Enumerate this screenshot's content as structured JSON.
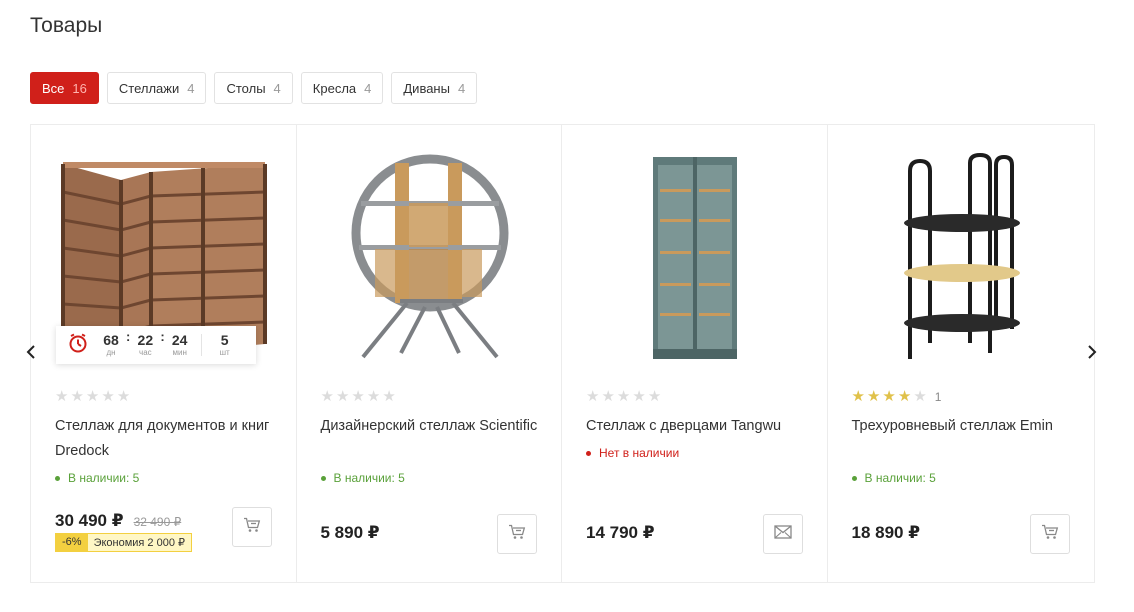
{
  "page": {
    "title": "Товары"
  },
  "filters": [
    {
      "label": "Все",
      "count": "16"
    },
    {
      "label": "Стеллажи",
      "count": "4"
    },
    {
      "label": "Столы",
      "count": "4"
    },
    {
      "label": "Кресла",
      "count": "4"
    },
    {
      "label": "Диваны",
      "count": "4"
    }
  ],
  "products": [
    {
      "name": "Стеллаж для документов и книг Dredock",
      "rating": 0,
      "stock": "В наличии: 5",
      "price": "30 490 ₽",
      "old_price": "32 490 ₽",
      "discount": "-6%",
      "economy": "Экономия 2 000 ₽",
      "action_icon": "cart-icon",
      "timer": {
        "days": "68",
        "days_label": "дн",
        "hours": "22",
        "hours_label": "час",
        "minutes": "24",
        "minutes_label": "мин",
        "qty": "5",
        "qty_label": "шт"
      }
    },
    {
      "name": "Дизайнерский стеллаж Scientific",
      "rating": 0,
      "stock": "В наличии: 5",
      "price": "5 890 ₽",
      "action_icon": "cart-icon"
    },
    {
      "name": "Стеллаж с дверцами Tangwu",
      "rating": 0,
      "stock": "Нет в наличии",
      "price": "14 790 ₽",
      "action_icon": "envelope-icon"
    },
    {
      "name": "Трехуровневый стеллаж Emin",
      "rating": 4,
      "rating_count": "1",
      "stock": "В наличии: 5",
      "price": "18 890 ₽",
      "action_icon": "cart-icon"
    }
  ],
  "colors": {
    "accent": "#d0201a",
    "in_stock": "#5aa13a",
    "out_of_stock": "#d0201a",
    "star": "#e0c14a",
    "discount": "#f3d040"
  },
  "navigation": {
    "prev_icon": "chevron-left-icon",
    "next_icon": "chevron-right-icon"
  }
}
